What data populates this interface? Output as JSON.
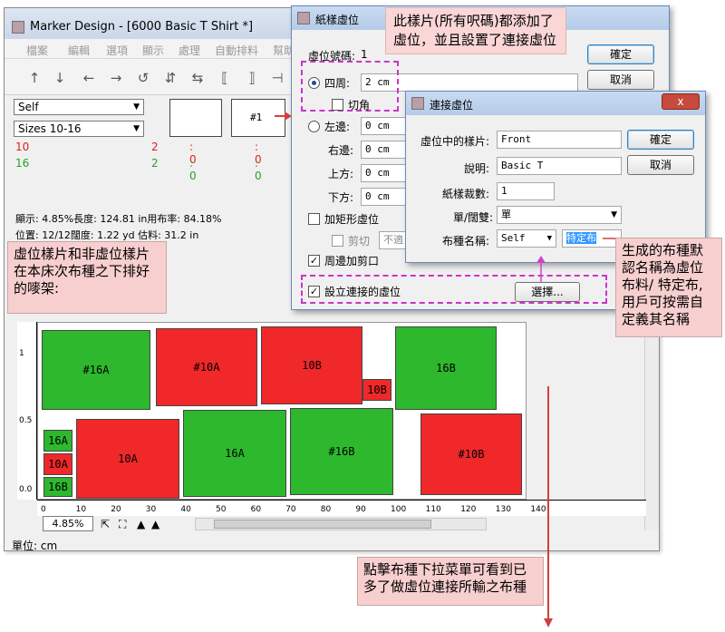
{
  "main_window": {
    "title": "Marker Design - [6000 Basic T Shirt *]",
    "menu": [
      "檔案",
      "編輯",
      "選項",
      "顯示",
      "處理",
      "自動排料",
      "幫助"
    ],
    "self_combo": "Self",
    "sizes_combo": "Sizes 10-16",
    "row1": {
      "size": "10",
      "a": "2",
      "b": ": 0",
      "c": ": 0"
    },
    "row2": {
      "size": "16",
      "a": "2",
      "b": ": 0",
      "c": ": 0"
    },
    "thumb_label": "#1",
    "info1": "顯示:   4.85%長度:  124.81  in用布率:  84.18%",
    "info2": "位置:  12/12闊度:   1.22 yd    估料:  31.2 in",
    "zoom": "4.85%",
    "status": "單位: cm",
    "vruler": [
      "1",
      "0.5",
      "0.0"
    ],
    "hruler": [
      "0",
      "10",
      "20",
      "30",
      "40",
      "50",
      "60",
      "70",
      "80",
      "90",
      "100",
      "110",
      "120",
      "130",
      "140"
    ]
  },
  "pieces": {
    "p1": "#16A",
    "p2": "#10A",
    "p3": "10B",
    "p4": "10B",
    "p5": "16B",
    "p6": "16A",
    "p7": "10A",
    "p8": "16B",
    "p9": "10A",
    "p10": "16A",
    "p11": "#16B",
    "p12": "#10B"
  },
  "dialog_buffer": {
    "title": "紙樣虛位",
    "id_label": "虛位號碼:",
    "id_value": "1",
    "ok": "確定",
    "cancel": "取消",
    "around_label": "四周:",
    "around_value": "2 cm",
    "corner_label": "切角",
    "left_label": "左邊:",
    "left_value": "0 cm",
    "right_label": "右邊:",
    "right_value": "0 cm",
    "top_label": "上方:",
    "top_value": "0 cm",
    "bottom_label": "下方:",
    "bottom_value": "0 cm",
    "rect_label": "加矩形虛位",
    "cut_label": "剪切",
    "fit_value": "不適",
    "perimeter_label": "周邊加剪口",
    "linked_label": "設立連接的虛位",
    "select_button": "選擇..."
  },
  "dialog_linked": {
    "title": "連接虛位",
    "close": "x",
    "piece_label": "虛位中的樣片:",
    "piece_value": "Front",
    "desc_label": "說明:",
    "desc_value": "Basic T",
    "count_label": "紙樣裁數:",
    "count_value": "1",
    "pair_label": "單/闊雙:",
    "pair_value": "單",
    "fabric_label": "布種名稱:",
    "fabric_value": "Self",
    "fabric_name": "特定布",
    "ok": "確定",
    "cancel": "取消"
  },
  "callouts": {
    "top": "此樣片(所有呎碼)都添加了\n虛位，並且設置了連接虛位",
    "left": "虛位樣片和非虛位樣片\n在本床次布種之下排好\n的嘜架:",
    "right": "生成的布種默\n認名稱為虛位\n布料/ 特定布,\n用戶可按需自\n定義其名稱",
    "bottom": "點擊布種下拉菜單可看到已\n多了做虛位連接所輸之布種"
  },
  "colors": {
    "green": "#2db82d",
    "red": "#f0282a",
    "callout": "#f8cfcf",
    "arrow": "#d04040",
    "dash": "#cc33cc"
  }
}
